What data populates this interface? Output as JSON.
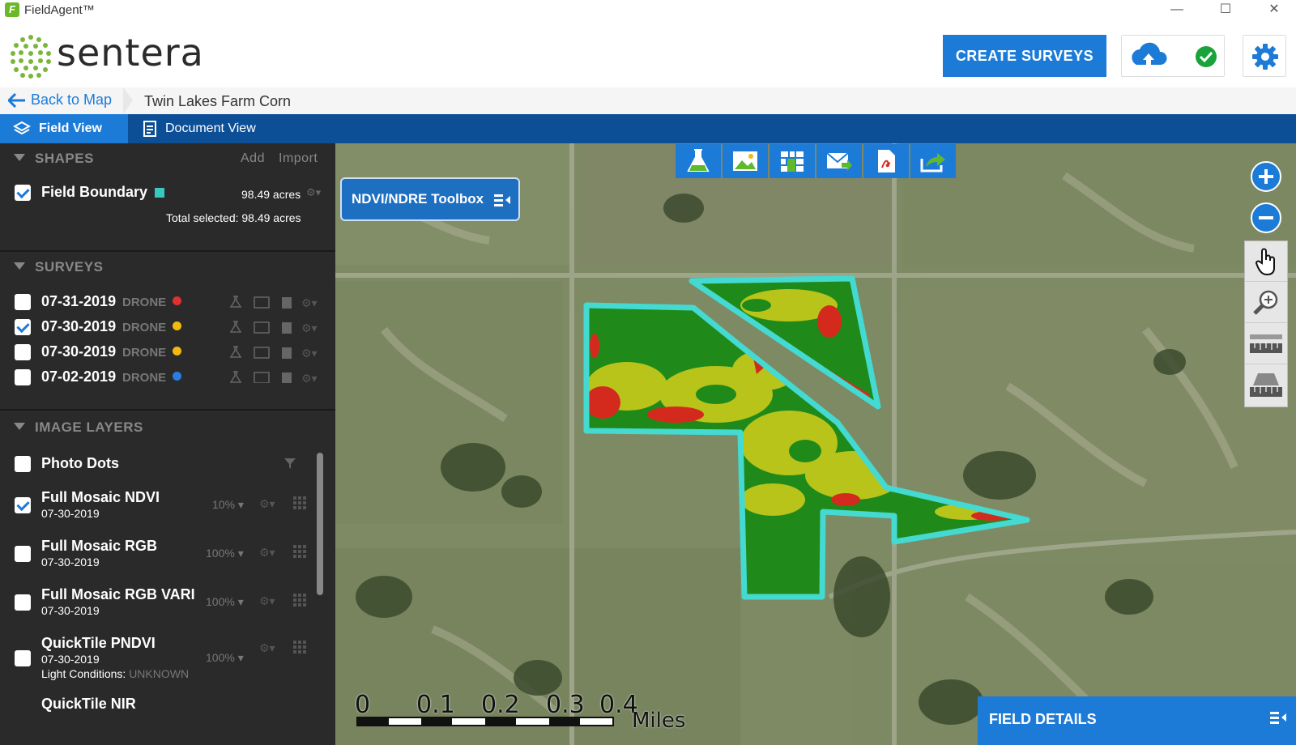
{
  "app": {
    "title": "FieldAgent™",
    "logo_text": "sentera"
  },
  "header": {
    "create_label": "CREATE SURVEYS",
    "colors": {
      "accent": "#1d7bd8",
      "nav": "#0c4f97",
      "success": "#1aa33a"
    }
  },
  "breadcrumb": {
    "back_label": "Back to Map",
    "title": "Twin Lakes Farm Corn"
  },
  "tabs": [
    {
      "label": "Field View"
    },
    {
      "label": "Document View"
    }
  ],
  "shapes": {
    "title": "SHAPES",
    "add_label": "Add",
    "import_label": "Import",
    "items": [
      {
        "name": "Field Boundary",
        "acres": "98.49 acres",
        "checked": true,
        "swatch": "#36c9c0"
      }
    ],
    "total": "Total selected: 98.49 acres"
  },
  "surveys": {
    "title": "SURVEYS",
    "items": [
      {
        "date": "07-31-2019",
        "type": "DRONE",
        "color": "#e03030",
        "checked": false
      },
      {
        "date": "07-30-2019",
        "type": "DRONE",
        "color": "#f2b90f",
        "checked": true
      },
      {
        "date": "07-30-2019",
        "type": "DRONE",
        "color": "#f2b90f",
        "checked": false
      },
      {
        "date": "07-02-2019",
        "type": "DRONE",
        "color": "#2a7de1",
        "checked": false
      }
    ]
  },
  "image_layers": {
    "title": "IMAGE LAYERS",
    "photo_dots": "Photo Dots",
    "items": [
      {
        "name": "Full Mosaic NDVI",
        "date": "07-30-2019",
        "opacity": "10%",
        "checked": true
      },
      {
        "name": "Full Mosaic RGB",
        "date": "07-30-2019",
        "opacity": "100%",
        "checked": false
      },
      {
        "name": "Full Mosaic RGB VARI",
        "date": "07-30-2019",
        "opacity": "100%",
        "checked": false
      },
      {
        "name": "QuickTile PNDVI",
        "date": "07-30-2019",
        "opacity": "100%",
        "checked": false,
        "light_label": "Light Conditions:",
        "light_value": "UNKNOWN"
      }
    ],
    "last_item": "QuickTile NIR"
  },
  "map": {
    "toolbox_label": "NDVI/NDRE Toolbox",
    "field_details_label": "FIELD DETAILS",
    "scale": {
      "ticks": [
        "0",
        "0.1",
        "0.2",
        "0.3",
        "0.4"
      ],
      "unit": "Miles"
    },
    "icons": [
      "flask-icon",
      "image-icon",
      "tiles-icon",
      "mail-icon",
      "pdf-icon",
      "share-icon"
    ]
  }
}
